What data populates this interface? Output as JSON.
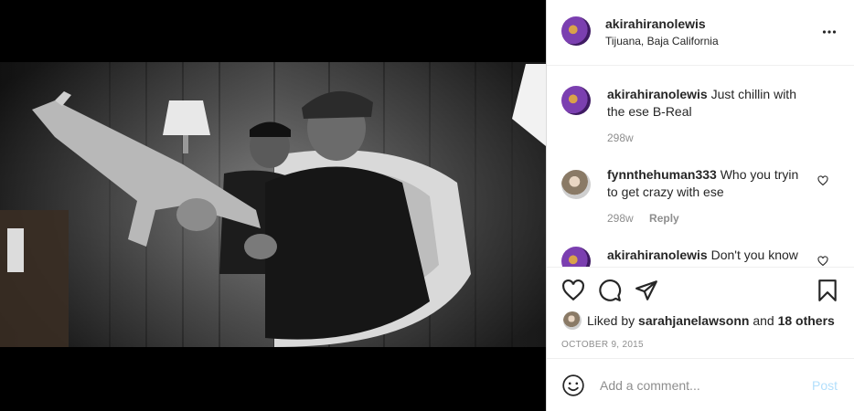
{
  "post": {
    "username": "akirahiranolewis",
    "location": "Tijuana, Baja California",
    "more_icon": "more-horizontal-icon"
  },
  "comments": [
    {
      "username": "akirahiranolewis",
      "text": "Just chillin with the ese B-Real",
      "age": "298w",
      "reply": ""
    },
    {
      "username": "fynnthehuman333",
      "text": "Who you tryin to get crazy with ese",
      "age": "298w",
      "reply": "Reply"
    },
    {
      "username": "akirahiranolewis",
      "text": "Don't you know",
      "age": "",
      "reply": ""
    }
  ],
  "likes": {
    "prefix": "Liked by",
    "user": "sarahjanelawsonn",
    "and": "and",
    "others": "18 others"
  },
  "date": "OCTOBER 9, 2015",
  "add_comment": {
    "placeholder": "Add a comment...",
    "post_label": "Post"
  },
  "colors": {
    "post_button_disabled": "#b2dffc",
    "secondary_text": "#8e8e8e",
    "primary_text": "#262626"
  }
}
